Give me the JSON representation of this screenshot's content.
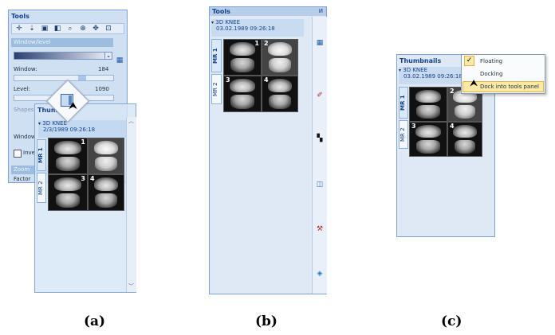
{
  "panel_a": {
    "tools_title": "Tools",
    "section_window_level": "Window/level",
    "window_label": "Window:",
    "window_value": "184",
    "level_label": "Level:",
    "level_value": "1090",
    "shapes_label": "Shapes",
    "window_label_2": "Window",
    "invert_label": "Inve",
    "zoom_label": "Zoom",
    "factor_label": "Factor",
    "thumbnails_title": "Thumb",
    "series_name": "3D KNEE",
    "series_date": "2/3/1989 09:26:18",
    "tab_mr1": "MR 1",
    "tab_mr2": "MR 2",
    "thumb_numbers": [
      "1",
      "2",
      "3",
      "4"
    ]
  },
  "panel_b": {
    "tools_title": "Tools",
    "pin_glyph": "ⵍ",
    "series_name": "3D KNEE",
    "series_date": "03.02.1989 09:26:18",
    "tab_mr1": "MR 1",
    "tab_mr2": "MR 2",
    "thumb_numbers": [
      "1",
      "2",
      "3",
      "4"
    ]
  },
  "panel_c": {
    "thumbnails_title": "Thumbnails",
    "series_name": "3D KNEE",
    "series_date": "03.02.1989 09:26:18",
    "tab_mr1": "MR 1",
    "tab_mr2": "MR 2",
    "thumb_numbers": [
      "1",
      "2",
      "3",
      "4"
    ],
    "menu": {
      "items": [
        "Floating",
        "Docking",
        "Dock into tools panel"
      ],
      "checked_index": 0,
      "hovered_index": 2
    }
  },
  "captions": [
    "(a)",
    "(b)",
    "(c)"
  ],
  "colors": {
    "panel_bg": "#cfe0f3",
    "panel_border": "#7fa3cf",
    "title_text": "#15428b",
    "menu_highlight": "#fde9a6"
  }
}
